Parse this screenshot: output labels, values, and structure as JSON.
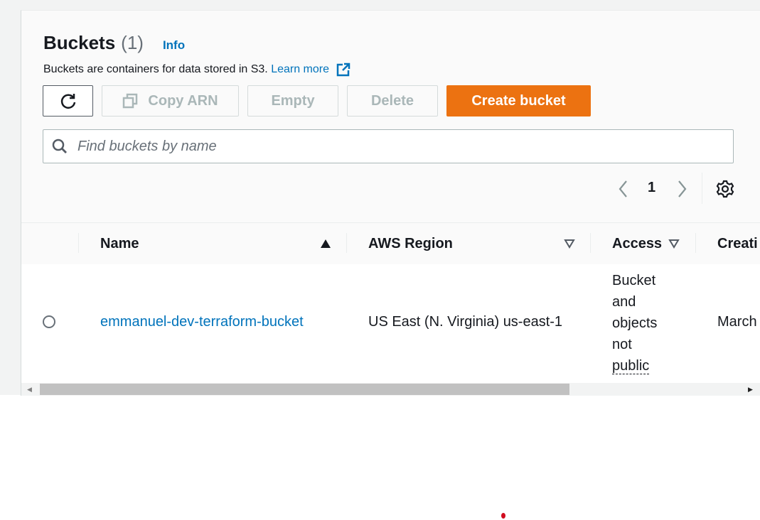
{
  "header": {
    "title": "Buckets",
    "count": "(1)",
    "info_label": "Info",
    "description": "Buckets are containers for data stored in S3.",
    "learn_more": "Learn more"
  },
  "toolbar": {
    "refresh_icon": "refresh-icon",
    "copy_arn_label": "Copy ARN",
    "empty_label": "Empty",
    "delete_label": "Delete",
    "create_label": "Create bucket"
  },
  "search": {
    "placeholder": "Find buckets by name",
    "value": ""
  },
  "pagination": {
    "current_page": "1"
  },
  "table": {
    "columns": [
      {
        "label": "Name",
        "sort": "ascending"
      },
      {
        "label": "AWS Region",
        "sort": "none"
      },
      {
        "label": "Access",
        "sort": "none"
      },
      {
        "label": "Creati"
      }
    ],
    "rows": [
      {
        "name": "emmanuel-dev-terraform-bucket",
        "region": "US East (N. Virginia) us-east-1",
        "access_lines": [
          "Bucket",
          "and",
          "objects",
          "not",
          "public"
        ],
        "created": "March"
      }
    ]
  },
  "colors": {
    "link": "#0073bb",
    "primary_button": "#ec7211",
    "text": "#16191f"
  }
}
